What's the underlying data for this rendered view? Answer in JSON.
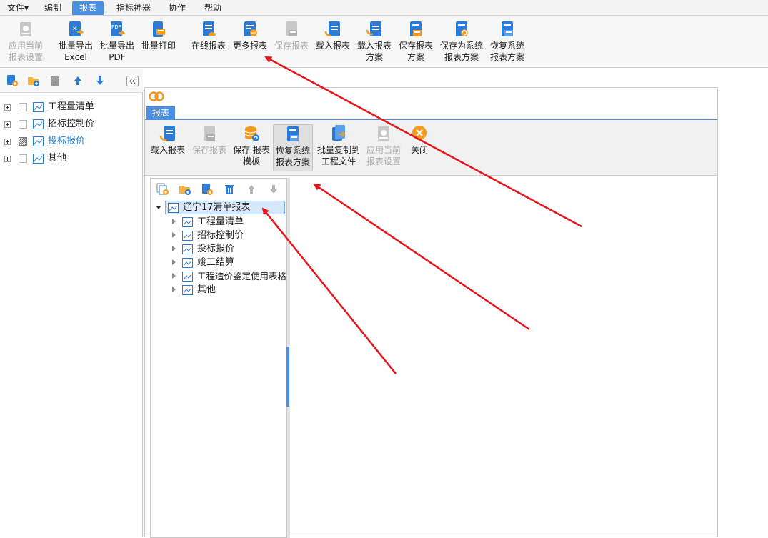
{
  "menubar": {
    "items": [
      "文件▾",
      "编制",
      "报表",
      "指标神器",
      "协作",
      "帮助"
    ],
    "active": "报表"
  },
  "ribbon": {
    "buttons": [
      {
        "line1": "应用当前",
        "line2": "报表设置",
        "icon": "apply-settings-icon",
        "enabled": false
      },
      {
        "line1": "批量导出",
        "line2": "Excel",
        "icon": "excel-export-icon",
        "enabled": true
      },
      {
        "line1": "批量导出",
        "line2": "PDF",
        "icon": "pdf-export-icon",
        "enabled": true
      },
      {
        "line1": "批量打印",
        "line2": "",
        "icon": "print-icon",
        "enabled": true
      },
      {
        "line1": "在线报表",
        "line2": "",
        "icon": "online-report-icon",
        "enabled": true
      },
      {
        "line1": "更多报表",
        "line2": "",
        "icon": "more-reports-icon",
        "enabled": true
      },
      {
        "line1": "保存报表",
        "line2": "",
        "icon": "save-report-icon",
        "enabled": false
      },
      {
        "line1": "载入报表",
        "line2": "",
        "icon": "load-report-icon",
        "enabled": true
      },
      {
        "line1": "载入报表",
        "line2": "方案",
        "icon": "load-scheme-icon",
        "enabled": true
      },
      {
        "line1": "保存报表",
        "line2": "方案",
        "icon": "save-scheme-icon",
        "enabled": true
      },
      {
        "line1": "保存为系统",
        "line2": "报表方案",
        "icon": "save-system-scheme-icon",
        "enabled": true
      },
      {
        "line1": "恢复系统",
        "line2": "报表方案",
        "icon": "restore-system-scheme-icon",
        "enabled": true
      }
    ]
  },
  "left_tree": {
    "items": [
      {
        "label": "工程量清单",
        "checked": "none"
      },
      {
        "label": "招标控制价",
        "checked": "none"
      },
      {
        "label": "投标报价",
        "checked": "partial"
      },
      {
        "label": "其他",
        "checked": "none"
      }
    ]
  },
  "dialog": {
    "tab": "报表",
    "buttons": [
      {
        "line1": "载入报表",
        "line2": "",
        "icon": "load-report-icon",
        "enabled": true
      },
      {
        "line1": "保存报表",
        "line2": "",
        "icon": "save-report-icon",
        "enabled": false
      },
      {
        "line1": "保存",
        "line2": "报表模板",
        "icon": "save-template-icon",
        "enabled": true
      },
      {
        "line1": "恢复系统",
        "line2": "报表方案",
        "icon": "restore-system-scheme-icon",
        "enabled": true,
        "pressed": true
      },
      {
        "line1": "批量复制到",
        "line2": "工程文件",
        "icon": "batch-copy-icon",
        "enabled": true
      },
      {
        "line1": "应用当前",
        "line2": "报表设置",
        "icon": "apply-settings-icon",
        "enabled": false
      },
      {
        "line1": "关闭",
        "line2": "",
        "icon": "close-icon",
        "enabled": true
      }
    ],
    "tree": {
      "root": "辽宁17清单报表",
      "children": [
        "工程量清单",
        "招标控制价",
        "投标报价",
        "竣工结算",
        "工程造价鉴定使用表格",
        "其他"
      ]
    }
  },
  "colors": {
    "accent": "#4b8fe0",
    "annotation": "#e8141b",
    "link": "#1a7fd4"
  }
}
